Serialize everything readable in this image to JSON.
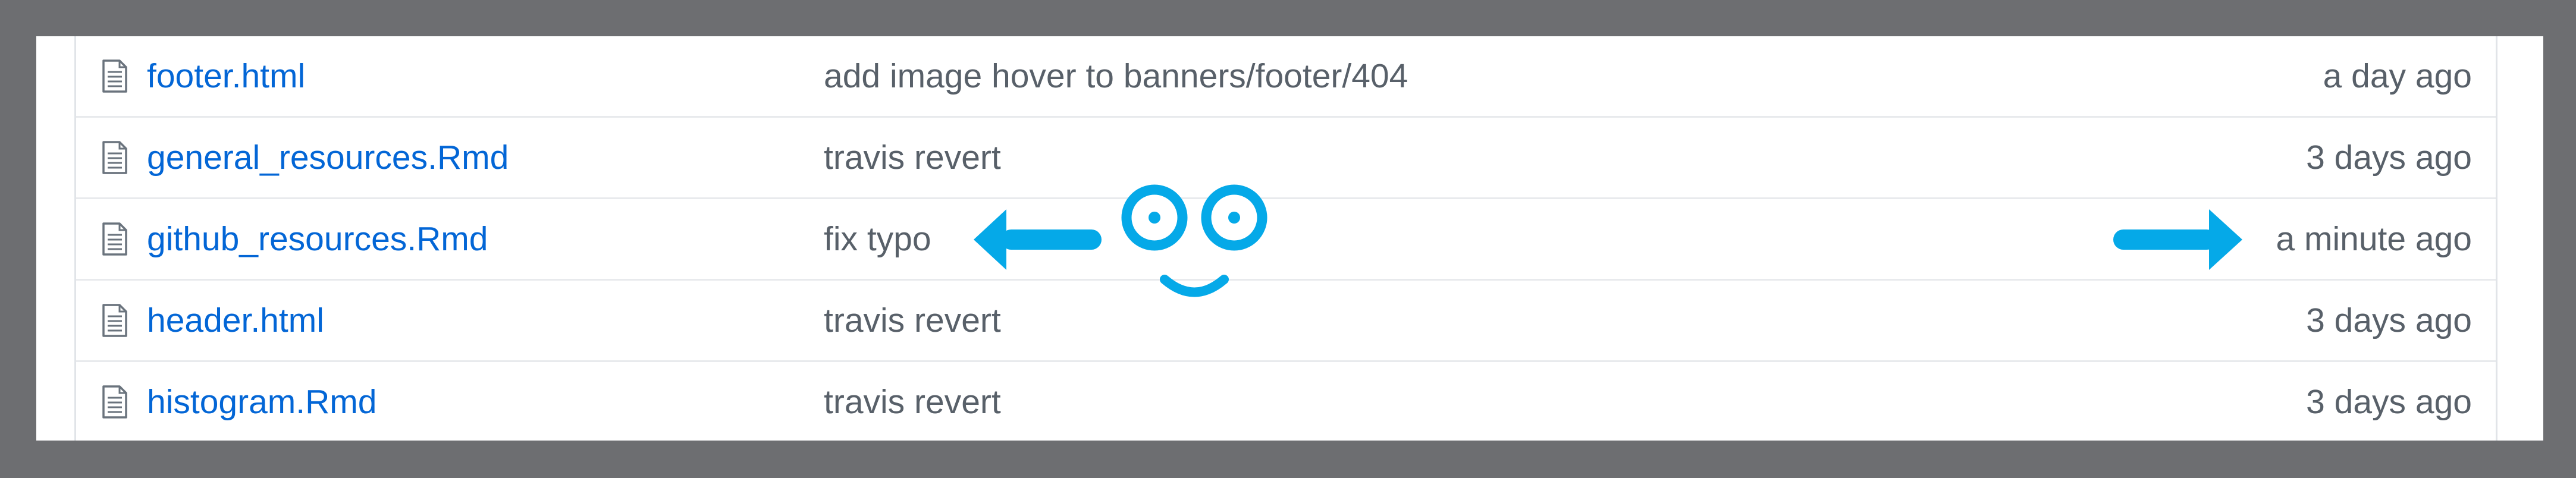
{
  "files": [
    {
      "icon": "file-text-icon",
      "name": "footer.html",
      "message": "add image hover to banners/footer/404",
      "age": "a day ago"
    },
    {
      "icon": "file-text-icon",
      "name": "general_resources.Rmd",
      "message": "travis revert",
      "age": "3 days ago"
    },
    {
      "icon": "file-text-icon",
      "name": "github_resources.Rmd",
      "message": "fix typo",
      "age": "a minute ago"
    },
    {
      "icon": "file-text-icon",
      "name": "header.html",
      "message": "travis revert",
      "age": "3 days ago"
    },
    {
      "icon": "file-text-icon",
      "name": "histogram.Rmd",
      "message": "travis revert",
      "age": "3 days ago"
    }
  ],
  "annotation": {
    "color": "#05a9e8",
    "left_arrow_icon": "arrow-left-icon",
    "right_arrow_icon": "arrow-right-icon",
    "face_icon": "smiley-face-icon"
  },
  "colors": {
    "frame": "#6d6e71",
    "link": "#0366d6",
    "muted_text": "#586069",
    "border": "#e1e4e8"
  }
}
